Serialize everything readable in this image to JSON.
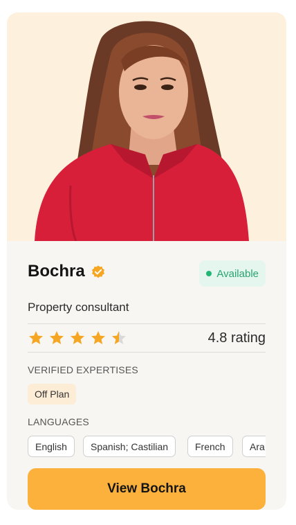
{
  "agent": {
    "name": "Bochra",
    "role": "Property consultant",
    "status": "Available",
    "rating": 4.8,
    "rating_label": "4.8 rating",
    "stars_filled_fraction": 0.96
  },
  "sections": {
    "expertises_label": "VERIFIED EXPERTISES",
    "expertises": [
      "Off Plan"
    ],
    "languages_label": "LANGUAGES",
    "languages": [
      "English",
      "Spanish; Castilian",
      "French",
      "Ara"
    ]
  },
  "cta": {
    "label": "View Bochra"
  },
  "colors": {
    "photo_bg": "#fdf0dc",
    "card_bg": "#f8f6f2",
    "accent": "#fbb13c",
    "status_green": "#22b573",
    "verified_badge": "#f5a623"
  },
  "icons": {
    "verified": "verified-badge-icon",
    "star": "star-icon"
  }
}
